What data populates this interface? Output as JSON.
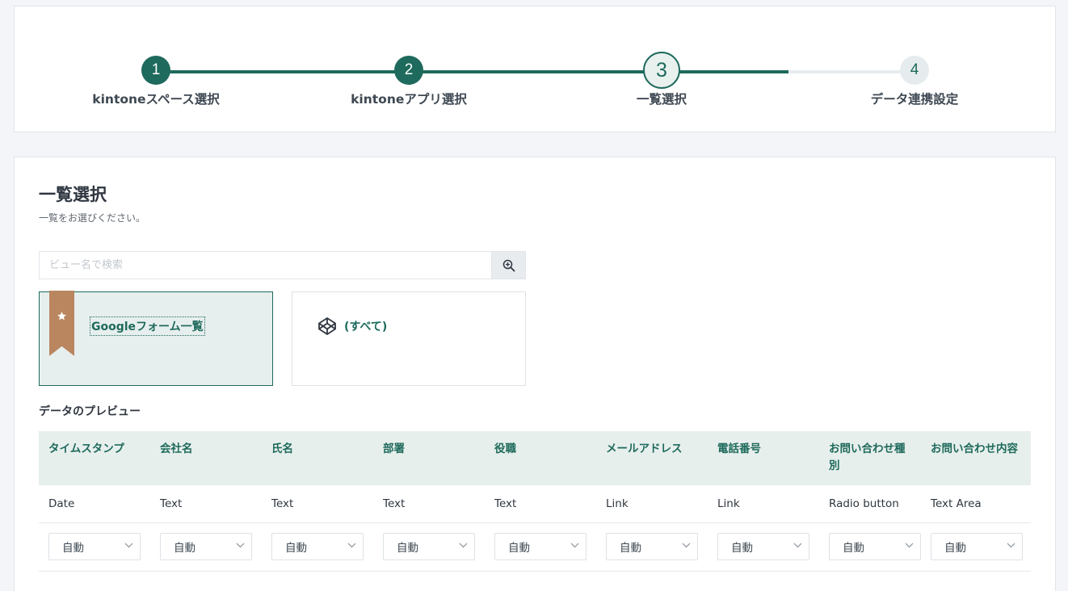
{
  "stepper": {
    "steps": [
      {
        "number": "1",
        "label": "kintoneスペース選択",
        "state": "done"
      },
      {
        "number": "2",
        "label": "kintoneアプリ選択",
        "state": "done"
      },
      {
        "number": "3",
        "label": "一覧選択",
        "state": "current"
      },
      {
        "number": "4",
        "label": "データ連携設定",
        "state": "todo"
      }
    ]
  },
  "main": {
    "title": "一覧選択",
    "subtitle": "一覧をお選びください。",
    "search": {
      "placeholder": "ビュー名で検索",
      "value": "",
      "icon": "zoom-in-icon"
    },
    "views": [
      {
        "label": "Googleフォーム一覧",
        "selected": true,
        "icon": "star-ribbon-icon"
      },
      {
        "label": "(すべて)",
        "selected": false,
        "icon": "codepen-icon"
      }
    ],
    "preview": {
      "title": "データのプレビュー",
      "headers": [
        "タイムスタンプ",
        "会社名",
        "氏名",
        "部署",
        "役職",
        "メールアドレス",
        "電話番号",
        "お問い合わせ種別",
        "お問い合わせ内容"
      ],
      "types": [
        "Date",
        "Text",
        "Text",
        "Text",
        "Text",
        "Link",
        "Link",
        "Radio button",
        "Text Area"
      ],
      "selects": [
        "自動",
        "自動",
        "自動",
        "自動",
        "自動",
        "自動",
        "自動",
        "自動",
        "自動"
      ]
    }
  },
  "colors": {
    "accent": "#1e6a5c",
    "ribbon": "#b98660",
    "header_bg": "#e7efec",
    "todo": "#e6ecee"
  }
}
